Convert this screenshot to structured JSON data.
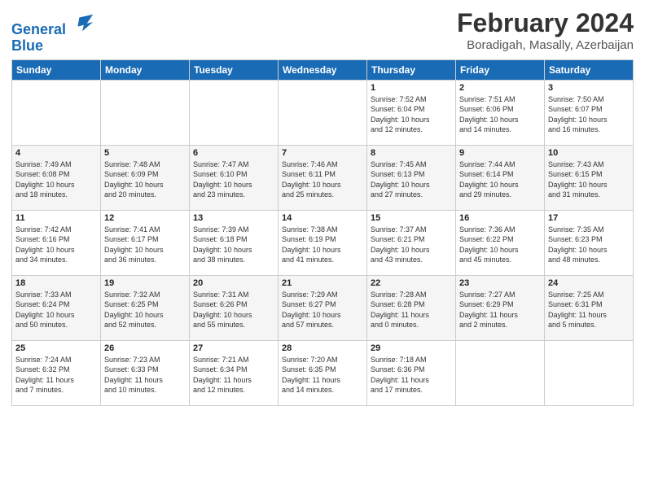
{
  "header": {
    "logo_line1": "General",
    "logo_line2": "Blue",
    "title": "February 2024",
    "subtitle": "Boradigah, Masally, Azerbaijan"
  },
  "columns": [
    "Sunday",
    "Monday",
    "Tuesday",
    "Wednesday",
    "Thursday",
    "Friday",
    "Saturday"
  ],
  "weeks": [
    [
      {
        "day": "",
        "info": ""
      },
      {
        "day": "",
        "info": ""
      },
      {
        "day": "",
        "info": ""
      },
      {
        "day": "",
        "info": ""
      },
      {
        "day": "1",
        "info": "Sunrise: 7:52 AM\nSunset: 6:04 PM\nDaylight: 10 hours\nand 12 minutes."
      },
      {
        "day": "2",
        "info": "Sunrise: 7:51 AM\nSunset: 6:06 PM\nDaylight: 10 hours\nand 14 minutes."
      },
      {
        "day": "3",
        "info": "Sunrise: 7:50 AM\nSunset: 6:07 PM\nDaylight: 10 hours\nand 16 minutes."
      }
    ],
    [
      {
        "day": "4",
        "info": "Sunrise: 7:49 AM\nSunset: 6:08 PM\nDaylight: 10 hours\nand 18 minutes."
      },
      {
        "day": "5",
        "info": "Sunrise: 7:48 AM\nSunset: 6:09 PM\nDaylight: 10 hours\nand 20 minutes."
      },
      {
        "day": "6",
        "info": "Sunrise: 7:47 AM\nSunset: 6:10 PM\nDaylight: 10 hours\nand 23 minutes."
      },
      {
        "day": "7",
        "info": "Sunrise: 7:46 AM\nSunset: 6:11 PM\nDaylight: 10 hours\nand 25 minutes."
      },
      {
        "day": "8",
        "info": "Sunrise: 7:45 AM\nSunset: 6:13 PM\nDaylight: 10 hours\nand 27 minutes."
      },
      {
        "day": "9",
        "info": "Sunrise: 7:44 AM\nSunset: 6:14 PM\nDaylight: 10 hours\nand 29 minutes."
      },
      {
        "day": "10",
        "info": "Sunrise: 7:43 AM\nSunset: 6:15 PM\nDaylight: 10 hours\nand 31 minutes."
      }
    ],
    [
      {
        "day": "11",
        "info": "Sunrise: 7:42 AM\nSunset: 6:16 PM\nDaylight: 10 hours\nand 34 minutes."
      },
      {
        "day": "12",
        "info": "Sunrise: 7:41 AM\nSunset: 6:17 PM\nDaylight: 10 hours\nand 36 minutes."
      },
      {
        "day": "13",
        "info": "Sunrise: 7:39 AM\nSunset: 6:18 PM\nDaylight: 10 hours\nand 38 minutes."
      },
      {
        "day": "14",
        "info": "Sunrise: 7:38 AM\nSunset: 6:19 PM\nDaylight: 10 hours\nand 41 minutes."
      },
      {
        "day": "15",
        "info": "Sunrise: 7:37 AM\nSunset: 6:21 PM\nDaylight: 10 hours\nand 43 minutes."
      },
      {
        "day": "16",
        "info": "Sunrise: 7:36 AM\nSunset: 6:22 PM\nDaylight: 10 hours\nand 45 minutes."
      },
      {
        "day": "17",
        "info": "Sunrise: 7:35 AM\nSunset: 6:23 PM\nDaylight: 10 hours\nand 48 minutes."
      }
    ],
    [
      {
        "day": "18",
        "info": "Sunrise: 7:33 AM\nSunset: 6:24 PM\nDaylight: 10 hours\nand 50 minutes."
      },
      {
        "day": "19",
        "info": "Sunrise: 7:32 AM\nSunset: 6:25 PM\nDaylight: 10 hours\nand 52 minutes."
      },
      {
        "day": "20",
        "info": "Sunrise: 7:31 AM\nSunset: 6:26 PM\nDaylight: 10 hours\nand 55 minutes."
      },
      {
        "day": "21",
        "info": "Sunrise: 7:29 AM\nSunset: 6:27 PM\nDaylight: 10 hours\nand 57 minutes."
      },
      {
        "day": "22",
        "info": "Sunrise: 7:28 AM\nSunset: 6:28 PM\nDaylight: 11 hours\nand 0 minutes."
      },
      {
        "day": "23",
        "info": "Sunrise: 7:27 AM\nSunset: 6:29 PM\nDaylight: 11 hours\nand 2 minutes."
      },
      {
        "day": "24",
        "info": "Sunrise: 7:25 AM\nSunset: 6:31 PM\nDaylight: 11 hours\nand 5 minutes."
      }
    ],
    [
      {
        "day": "25",
        "info": "Sunrise: 7:24 AM\nSunset: 6:32 PM\nDaylight: 11 hours\nand 7 minutes."
      },
      {
        "day": "26",
        "info": "Sunrise: 7:23 AM\nSunset: 6:33 PM\nDaylight: 11 hours\nand 10 minutes."
      },
      {
        "day": "27",
        "info": "Sunrise: 7:21 AM\nSunset: 6:34 PM\nDaylight: 11 hours\nand 12 minutes."
      },
      {
        "day": "28",
        "info": "Sunrise: 7:20 AM\nSunset: 6:35 PM\nDaylight: 11 hours\nand 14 minutes."
      },
      {
        "day": "29",
        "info": "Sunrise: 7:18 AM\nSunset: 6:36 PM\nDaylight: 11 hours\nand 17 minutes."
      },
      {
        "day": "",
        "info": ""
      },
      {
        "day": "",
        "info": ""
      }
    ]
  ]
}
